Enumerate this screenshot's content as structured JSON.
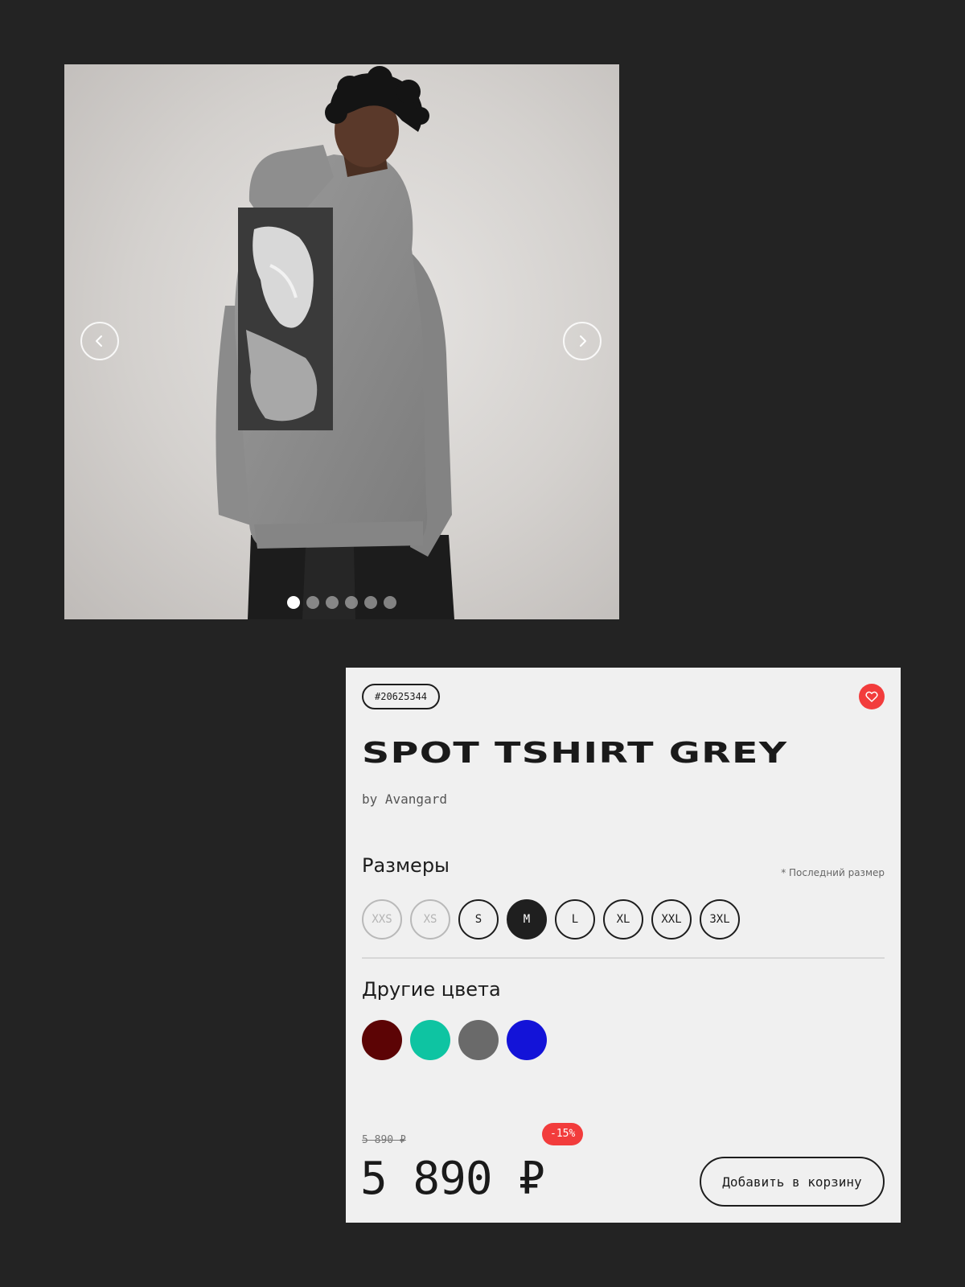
{
  "gallery": {
    "prev_icon": "chevron-left-icon",
    "next_icon": "chevron-right-icon",
    "dots_count": 6,
    "active_index": 0
  },
  "product": {
    "sku": "#20625344",
    "favorite_icon": "heart-icon",
    "title": "SPOT TSHIRT GREY",
    "brand": "by Avangard",
    "sizes_heading": "Размеры",
    "sizes_note": "* Последний размер",
    "sizes": [
      {
        "label": "XXS",
        "state": "disabled"
      },
      {
        "label": "XS",
        "state": "disabled"
      },
      {
        "label": "S",
        "state": "available"
      },
      {
        "label": "M",
        "state": "selected"
      },
      {
        "label": "L",
        "state": "available"
      },
      {
        "label": "XL",
        "state": "available"
      },
      {
        "label": "XXL",
        "state": "available"
      },
      {
        "label": "3XL",
        "state": "available"
      }
    ],
    "colors_heading": "Другие цвета",
    "colors": [
      "#5c0405",
      "#0ec4a2",
      "#6a6a6a",
      "#1313d8"
    ],
    "old_price": "5 890 ₽",
    "discount": "-15%",
    "price": "5 890 ₽",
    "add_to_cart": "Добавить в корзину"
  },
  "theme": {
    "accent_red": "#f23c3c",
    "card_background": "#f0f0f0",
    "page_background": "#232323"
  }
}
